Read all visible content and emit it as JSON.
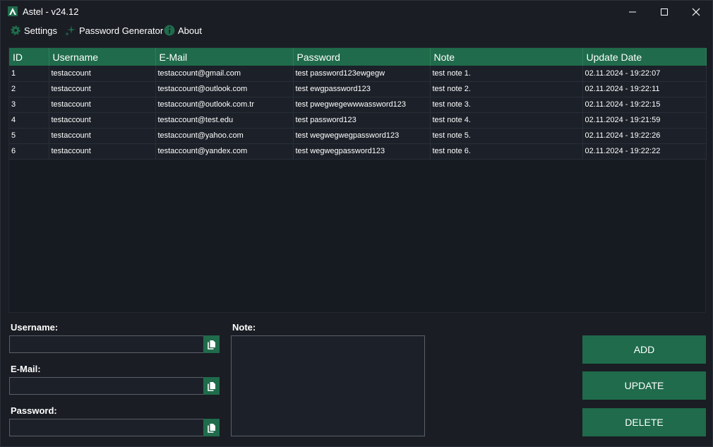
{
  "window": {
    "title": "Astel - v24.12"
  },
  "menu": {
    "settings": "Settings",
    "password_generator": "Password Generator",
    "about": "About"
  },
  "table": {
    "columns": [
      "ID",
      "Username",
      "E-Mail",
      "Password",
      "Note",
      "Update Date"
    ],
    "rows": [
      [
        "1",
        "testaccount",
        "testaccount@gmail.com",
        "test password123ewgegw",
        "test note 1.",
        "02.11.2024 - 19:22:07"
      ],
      [
        "2",
        "testaccount",
        "testaccount@outlook.com",
        "test ewgpassword123",
        "test note 2.",
        "02.11.2024 - 19:22:11"
      ],
      [
        "3",
        "testaccount",
        "testaccount@outlook.com.tr",
        "test pwegwegewwwassword123",
        "test note 3.",
        "02.11.2024 - 19:22:15"
      ],
      [
        "4",
        "testaccount",
        "testaccount@test.edu",
        "test password123",
        "test note 4.",
        "02.11.2024 - 19:21:59"
      ],
      [
        "5",
        "testaccount",
        "testaccount@yahoo.com",
        "test wegwegwegpassword123",
        "test note 5.",
        "02.11.2024 - 19:22:26"
      ],
      [
        "6",
        "testaccount",
        "testaccount@yandex.com",
        "test wegwegpassword123",
        "test note 6.",
        "02.11.2024 - 19:22:22"
      ]
    ]
  },
  "form": {
    "username_label": "Username:",
    "username_value": "",
    "email_label": "E-Mail:",
    "email_value": "",
    "password_label": "Password:",
    "password_value": "",
    "note_label": "Note:",
    "note_value": ""
  },
  "buttons": {
    "add": "ADD",
    "update": "UPDATE",
    "delete": "DELETE"
  },
  "icons": {
    "app": "astel-logo-icon",
    "settings": "gear-icon",
    "password_generator": "sparkle-icon",
    "about": "info-icon",
    "copy": "copy-icon"
  },
  "colors": {
    "accent": "#1f6b4b",
    "background": "#1a1d24",
    "row": "#1c2028"
  }
}
